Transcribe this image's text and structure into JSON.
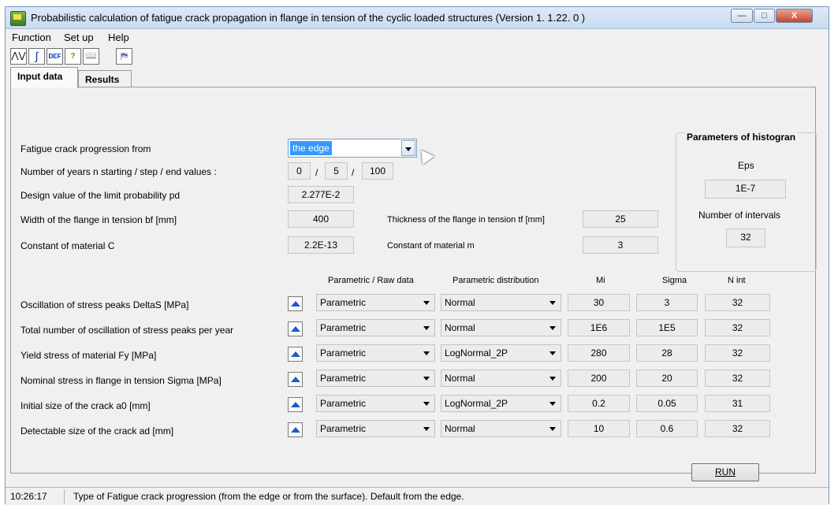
{
  "window": {
    "title": "Probabilistic calculation of fatigue crack propagation in flange in tension of the cyclic loaded structures (Version 1. 1.22. 0 )",
    "minimize": "—",
    "maximize": "□",
    "close": "X"
  },
  "menu": [
    "Function",
    "Set up",
    "Help"
  ],
  "toolbar": [
    {
      "icon": "graph-icon",
      "glyph": "⋀⋁"
    },
    {
      "icon": "integral-icon",
      "glyph": "∫"
    },
    {
      "icon": "def-icon",
      "glyph": "DEF"
    },
    {
      "icon": "help-icon",
      "glyph": "?"
    },
    {
      "icon": "book-icon",
      "glyph": "📖"
    },
    {
      "icon": "exit-icon",
      "glyph": "⛿"
    }
  ],
  "tabs": [
    "Input data",
    "Results"
  ],
  "form": {
    "crack_label": "Fatigue crack progression from",
    "crack_value": "the edge",
    "years_label": "Number of years n starting / step / end values :",
    "years": [
      "0",
      "5",
      "100"
    ],
    "sep": "/",
    "pd_label": "Design value of the limit probability pd",
    "pd_value": "2.277E-2",
    "bf_label": "Width of the flange in tension bf [mm]",
    "bf_value": "400",
    "tf_label": "Thickness of the flange in tension tf [mm]",
    "tf_value": "25",
    "c_label": "Constant of material  C",
    "c_value": "2.2E-13",
    "m_label": "Constant of material  m",
    "m_value": "3"
  },
  "histogram": {
    "title": "Parameters of histogran",
    "eps_label": "Eps",
    "eps_value": "1E-7",
    "intervals_label": "Number of intervals",
    "intervals_value": "32"
  },
  "table": {
    "headers": [
      "Parametric / Raw data",
      "Parametric distribution",
      "Mi",
      "Sigma",
      "N int"
    ],
    "rows": [
      {
        "label": "Oscillation of stress peaks DeltaS [MPa]",
        "mode": "Parametric",
        "dist": "Normal",
        "mi": "30",
        "sigma": "3",
        "nint": "32"
      },
      {
        "label": "Total number of oscillation of stress peaks per year",
        "mode": "Parametric",
        "dist": "Normal",
        "mi": "1E6",
        "sigma": "1E5",
        "nint": "32"
      },
      {
        "label": "Yield stress of material Fy [MPa]",
        "mode": "Parametric",
        "dist": "LogNormal_2P",
        "mi": "280",
        "sigma": "28",
        "nint": "32"
      },
      {
        "label": "Nominal stress in flange in tension Sigma [MPa]",
        "mode": "Parametric",
        "dist": "Normal",
        "mi": "200",
        "sigma": "20",
        "nint": "32"
      },
      {
        "label": "Initial size of the crack a0 [mm]",
        "mode": "Parametric",
        "dist": "LogNormal_2P",
        "mi": "0.2",
        "sigma": "0.05",
        "nint": "31"
      },
      {
        "label": "Detectable size of the crack ad [mm]",
        "mode": "Parametric",
        "dist": "Normal",
        "mi": "10",
        "sigma": "0.6",
        "nint": "32"
      }
    ]
  },
  "run_label": "RUN",
  "status": {
    "time": "10:26:17",
    "message": "Type of Fatigue crack progression (from the edge or from the surface). Default from the edge."
  }
}
